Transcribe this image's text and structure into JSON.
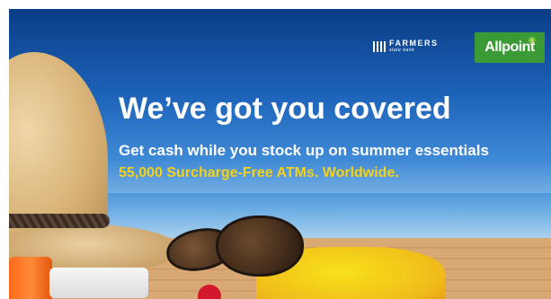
{
  "ad": {
    "bank_logo": {
      "icon": "stripes-logo-icon",
      "name": "FARMERS",
      "sub": "state bank"
    },
    "partner_logo": {
      "text": "Allpoint",
      "icon": "star-icon",
      "accent": "#3a9a36"
    },
    "headline": "We’ve got you covered",
    "subheadline": "Get cash while you stock up on summer essentials",
    "highlight": "55,000 Surcharge-Free ATMs. Worldwide.",
    "colors": {
      "sky": "#1d63ba",
      "highlight": "#f5d21a",
      "text": "#ffffff"
    }
  }
}
